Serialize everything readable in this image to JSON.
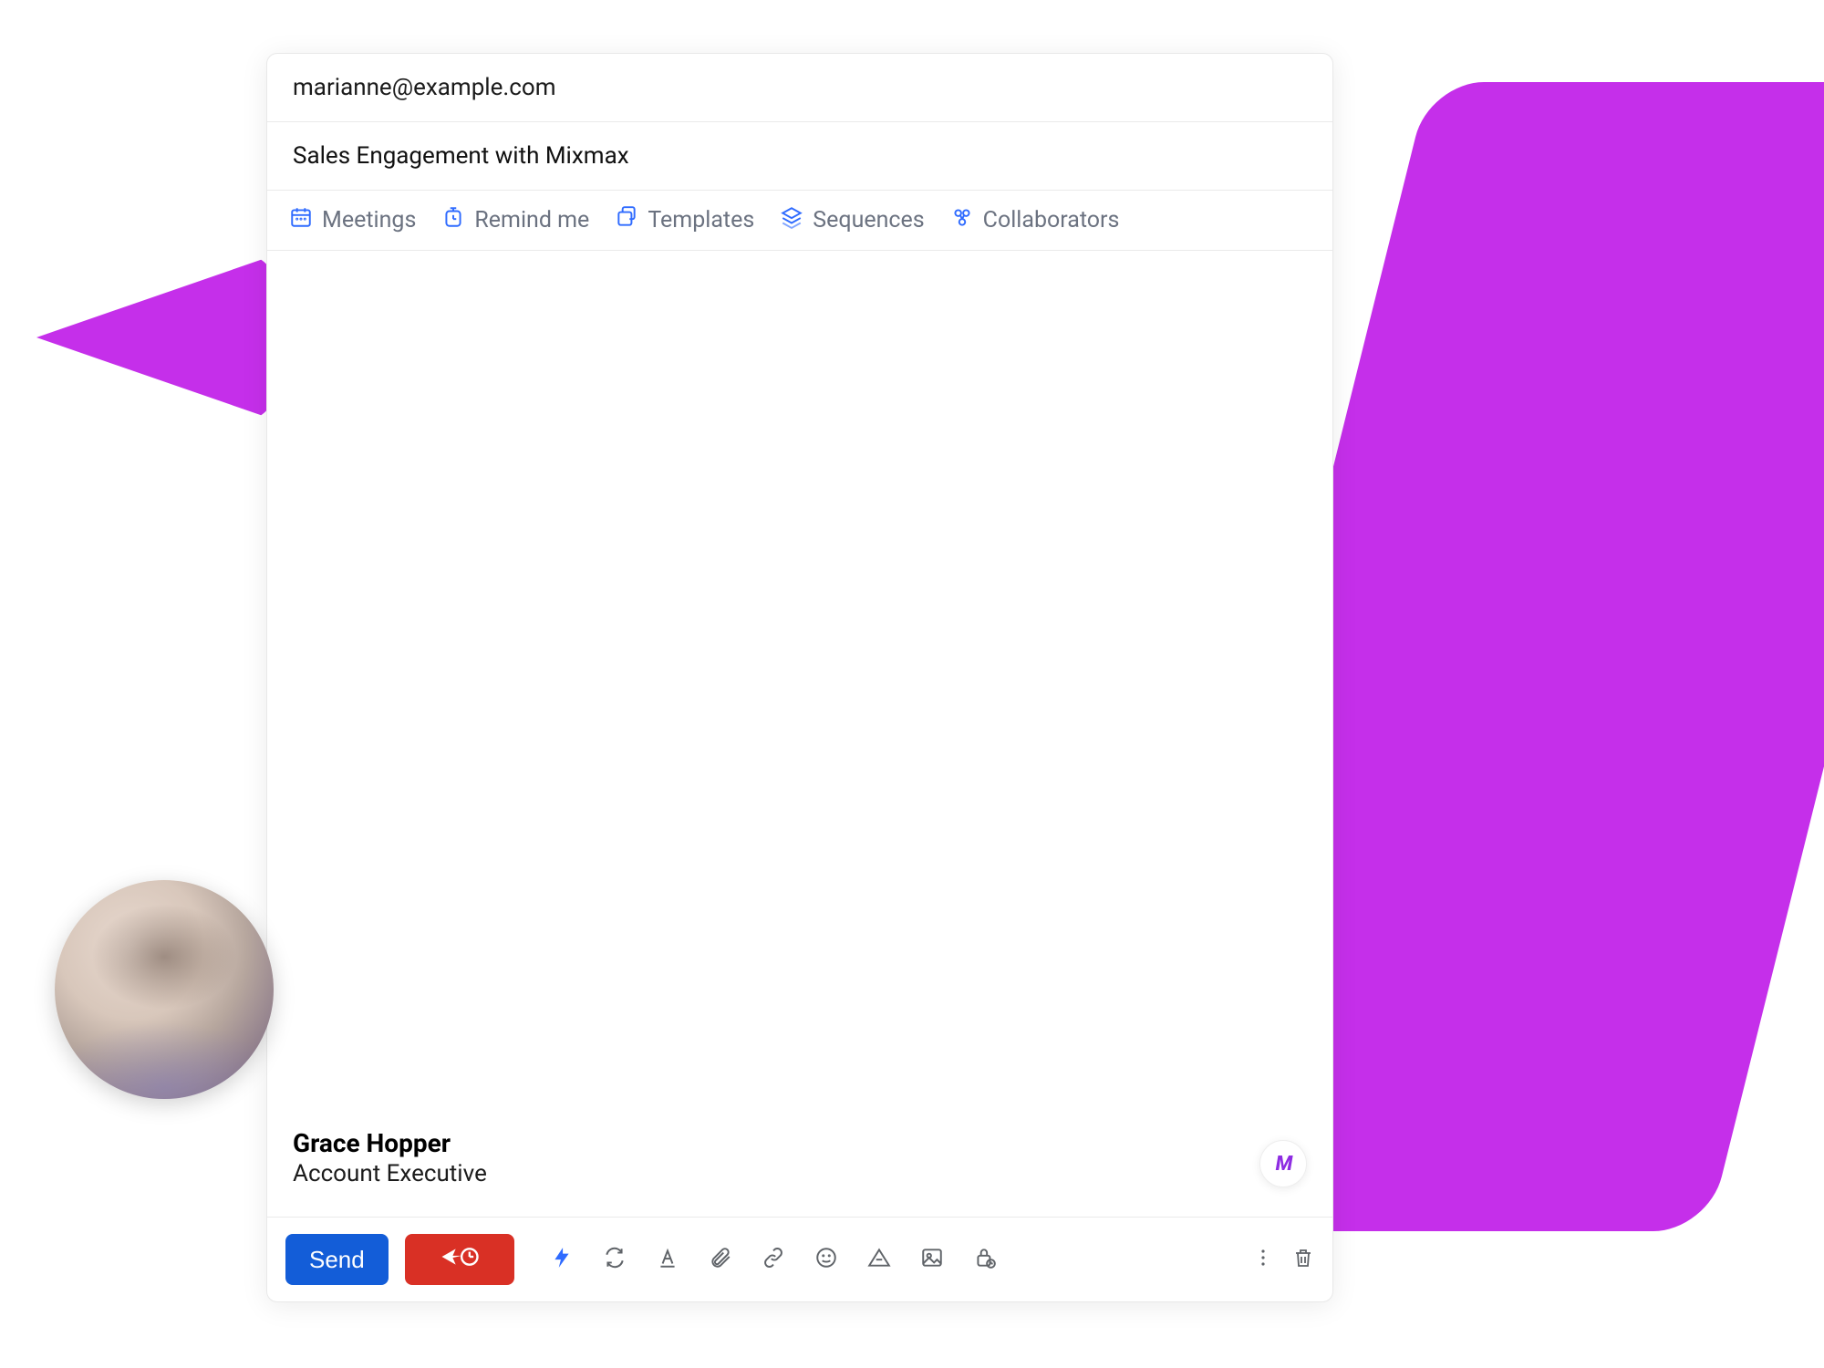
{
  "compose": {
    "to": "marianne@example.com",
    "subject": "Sales Engagement with Mixmax",
    "signature": {
      "name": "Grace Hopper",
      "title": "Account Executive"
    }
  },
  "toolbar": {
    "meetings": "Meetings",
    "remind_me": "Remind me",
    "templates": "Templates",
    "sequences": "Sequences",
    "collaborators": "Collaborators"
  },
  "footer": {
    "send_label": "Send"
  },
  "brand": {
    "badge": "M"
  },
  "colors": {
    "accent_purple": "#C52FEA",
    "primary_blue": "#135DD8",
    "danger_red": "#D93025",
    "icon_blue": "#2F6BFF",
    "text_muted": "#6b7280"
  }
}
